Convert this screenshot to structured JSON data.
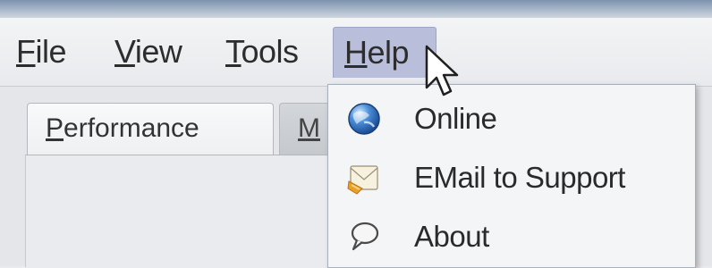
{
  "menubar": {
    "items": [
      {
        "label_mnemonic": "F",
        "label_rest": "ile"
      },
      {
        "label_mnemonic": "V",
        "label_rest": "iew"
      },
      {
        "label_mnemonic": "T",
        "label_rest": "ools"
      },
      {
        "label_mnemonic": "H",
        "label_rest": "elp"
      }
    ]
  },
  "tabs": [
    {
      "label_mnemonic": "P",
      "label_rest": "erformance"
    },
    {
      "label_mnemonic": "M",
      "label_rest": ""
    }
  ],
  "help_menu": {
    "items": [
      {
        "label": "Online",
        "icon": "globe-icon"
      },
      {
        "label": "EMail to Support",
        "icon": "envelope-icon"
      },
      {
        "label": "About",
        "icon": "speech-bubble-icon"
      }
    ]
  },
  "colors": {
    "menu_highlight": "#b9bedb",
    "dropdown_bg": "#f4f5f7"
  }
}
